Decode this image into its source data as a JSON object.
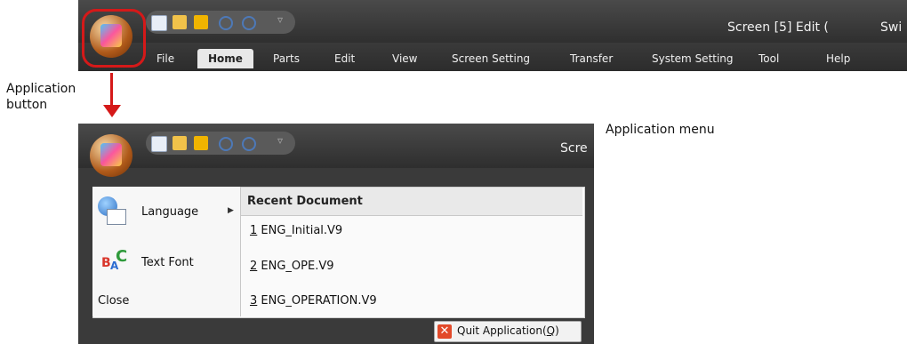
{
  "top_window": {
    "title_left": "Screen [5] Edit (",
    "title_right": "Swi",
    "tabs": [
      "File",
      "Home",
      "Parts",
      "Edit",
      "View",
      "Screen Setting",
      "Transfer",
      "System Setting",
      "Tool",
      "Help"
    ],
    "active_tab": "Home"
  },
  "callouts": {
    "application_button": "Application\nbutton",
    "application_menu": "Application menu"
  },
  "lower_window": {
    "title_partial": "Scre",
    "menu": {
      "left_items": [
        "Language",
        "Text Font"
      ],
      "close_label": "Close",
      "recent_header": "Recent Document",
      "recent_items": [
        {
          "index": "1",
          "name": " ENG_Initial.V9"
        },
        {
          "index": "2",
          "name": " ENG_OPE.V9"
        },
        {
          "index": "3",
          "name": " ENG_OPERATION.V9"
        }
      ],
      "quit_label": "Quit Application(",
      "quit_shortcut": "Q",
      "quit_suffix": ")"
    }
  },
  "colors": {
    "highlight_red": "#d51919",
    "ribbon_dark": "#3c3c3c",
    "tab_active_bg": "#e8e8e8"
  }
}
